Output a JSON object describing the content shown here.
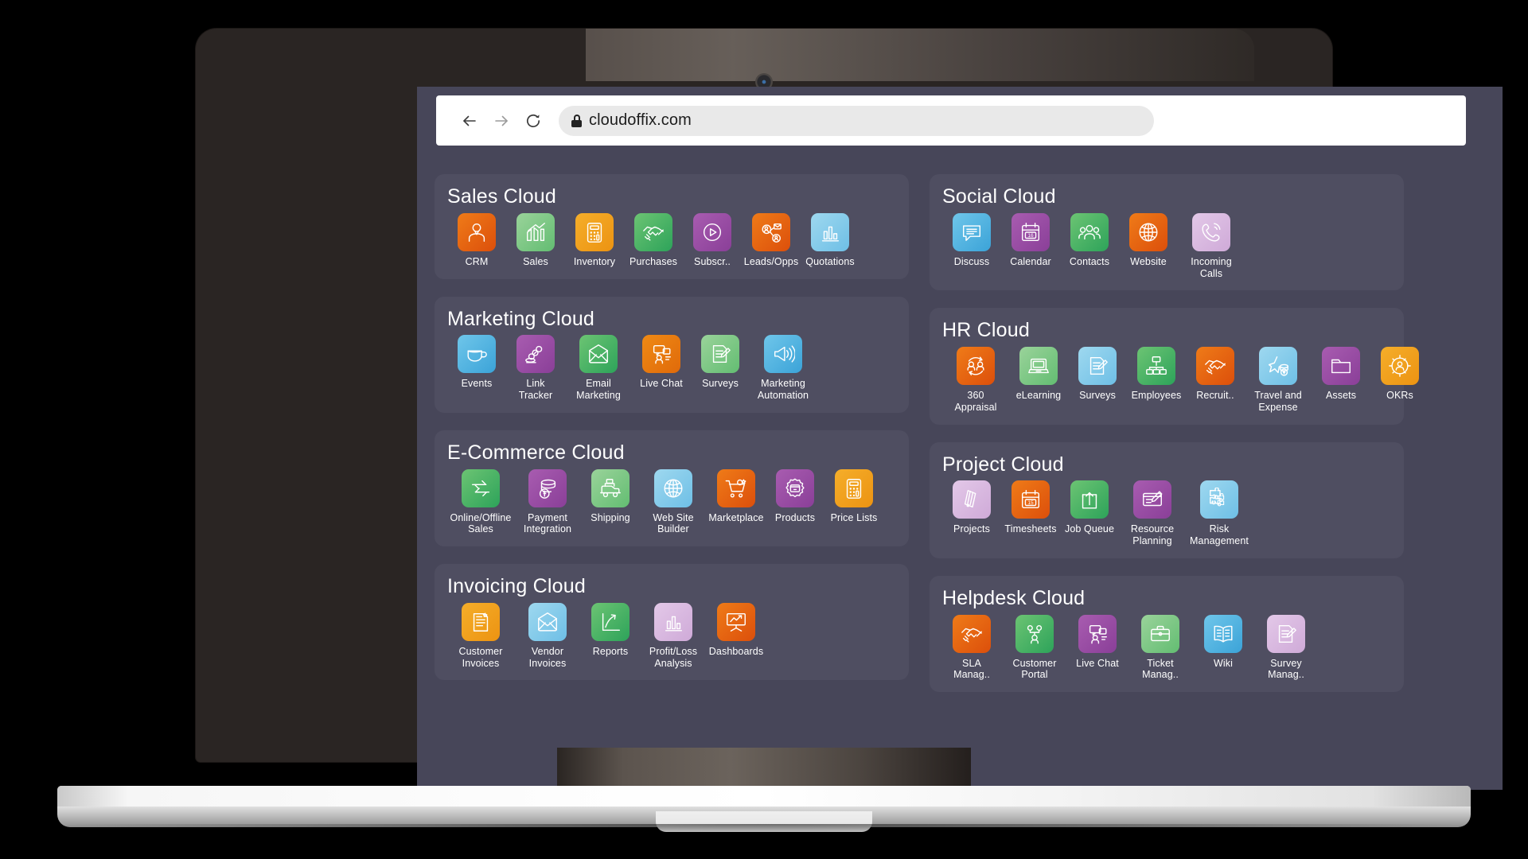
{
  "browser": {
    "back_label": "Back",
    "forward_label": "Forward",
    "reload_label": "Reload",
    "url": "cloudoffix.com",
    "lock_icon": "lock-icon"
  },
  "colors": {
    "page_bg": "#474659",
    "panel_bg": "#4f4e61",
    "orange": "#e8730d",
    "orange_red": "#e05a12",
    "green": "#42b35f",
    "light_green": "#82c97f",
    "purple": "#9b4fa5",
    "light_purple": "#d9b6df",
    "blue": "#57b4e2",
    "light_blue": "#86cbe9",
    "amber": "#f0a020"
  },
  "sections": [
    {
      "id": "sales-cloud",
      "title": "Sales Cloud",
      "column": "left",
      "apps": [
        {
          "label": "CRM",
          "icon": "user-profile-icon",
          "color": "orange-red"
        },
        {
          "label": "Sales",
          "icon": "bar-chart-growth-icon",
          "color": "light-green"
        },
        {
          "label": "Inventory",
          "icon": "calculator-icon",
          "color": "amber"
        },
        {
          "label": "Purchases",
          "icon": "handshake-icon",
          "color": "green"
        },
        {
          "label": "Subscr..",
          "icon": "play-circle-icon",
          "color": "purple"
        },
        {
          "label": "Leads/Opps",
          "icon": "leads-network-icon",
          "color": "orange-red"
        },
        {
          "label": "Quotations",
          "icon": "bar-chart-icon",
          "color": "light-blue"
        }
      ]
    },
    {
      "id": "social-cloud",
      "title": "Social Cloud",
      "column": "right",
      "apps": [
        {
          "label": "Discuss",
          "icon": "chat-bubble-icon",
          "color": "blue"
        },
        {
          "label": "Calendar",
          "icon": "calendar-icon",
          "color": "purple"
        },
        {
          "label": "Contacts",
          "icon": "people-group-icon",
          "color": "green"
        },
        {
          "label": "Website",
          "icon": "globe-icon",
          "color": "orange-red"
        },
        {
          "label": "Incoming\nCalls",
          "icon": "phone-ringing-icon",
          "color": "light-purple"
        }
      ]
    },
    {
      "id": "marketing-cloud",
      "title": "Marketing Cloud",
      "column": "left",
      "apps": [
        {
          "label": "Events",
          "icon": "coffee-cup-icon",
          "color": "blue"
        },
        {
          "label": "Link\nTracker",
          "icon": "link-chain-icon",
          "color": "purple"
        },
        {
          "label": "Email\nMarketing",
          "icon": "envelope-icon",
          "color": "green"
        },
        {
          "label": "Live Chat",
          "icon": "chat-support-icon",
          "color": "orange"
        },
        {
          "label": "Surveys",
          "icon": "survey-pencil-icon",
          "color": "light-green"
        },
        {
          "label": "Marketing\nAutomation",
          "icon": "megaphone-icon",
          "color": "blue"
        }
      ]
    },
    {
      "id": "hr-cloud",
      "title": "HR Cloud",
      "column": "right",
      "apps": [
        {
          "label": "360\nAppraisal",
          "icon": "appraisal-cycle-icon",
          "color": "orange-red"
        },
        {
          "label": "eLearning",
          "icon": "laptop-icon",
          "color": "light-green"
        },
        {
          "label": "Surveys",
          "icon": "survey-pencil-icon",
          "color": "light-blue"
        },
        {
          "label": "Employees",
          "icon": "org-chart-icon",
          "color": "green"
        },
        {
          "label": "Recruit..",
          "icon": "handshake-icon",
          "color": "orange-red"
        },
        {
          "label": "Travel and\nExpense",
          "icon": "travel-expense-icon",
          "color": "light-blue"
        },
        {
          "label": "Assets",
          "icon": "folder-icon",
          "color": "purple"
        },
        {
          "label": "OKRs",
          "icon": "okr-target-icon",
          "color": "amber"
        }
      ]
    },
    {
      "id": "ecommerce-cloud",
      "title": "E-Commerce Cloud",
      "column": "left",
      "apps": [
        {
          "label": "Online/Offline\nSales",
          "icon": "exchange-arrows-icon",
          "color": "green"
        },
        {
          "label": "Payment\nIntegration",
          "icon": "coins-stack-icon",
          "color": "purple"
        },
        {
          "label": "Shipping",
          "icon": "delivery-truck-icon",
          "color": "light-green"
        },
        {
          "label": "Web Site\nBuilder",
          "icon": "globe-icon",
          "color": "light-blue"
        },
        {
          "label": "Marketplace",
          "icon": "shopping-cart-icon",
          "color": "orange-red"
        },
        {
          "label": "Products",
          "icon": "gear-box-icon",
          "color": "purple"
        },
        {
          "label": "Price Lists",
          "icon": "calculator-icon",
          "color": "amber"
        }
      ]
    },
    {
      "id": "project-cloud",
      "title": "Project Cloud",
      "column": "right",
      "apps": [
        {
          "label": "Projects",
          "icon": "color-swatch-icon",
          "color": "light-purple"
        },
        {
          "label": "Timesheets",
          "icon": "calendar-15-icon",
          "color": "orange-red"
        },
        {
          "label": "Job Queue",
          "icon": "upload-box-icon",
          "color": "green"
        },
        {
          "label": "Resource\nPlanning",
          "icon": "planning-board-icon",
          "color": "purple"
        },
        {
          "label": "Risk\nManagement",
          "icon": "puzzle-icon",
          "color": "light-blue"
        }
      ]
    },
    {
      "id": "invoicing-cloud",
      "title": "Invoicing Cloud",
      "column": "left",
      "apps": [
        {
          "label": "Customer\nInvoices",
          "icon": "invoice-document-icon",
          "color": "amber"
        },
        {
          "label": "Vendor\nInvoices",
          "icon": "envelope-icon",
          "color": "light-blue"
        },
        {
          "label": "Reports",
          "icon": "growth-arrow-icon",
          "color": "green"
        },
        {
          "label": "Profit/Loss\nAnalysis",
          "icon": "bar-chart-icon",
          "color": "light-purple"
        },
        {
          "label": "Dashboards",
          "icon": "presentation-chart-icon",
          "color": "orange-red"
        }
      ]
    },
    {
      "id": "helpdesk-cloud",
      "title": "Helpdesk Cloud",
      "column": "right",
      "apps": [
        {
          "label": "SLA\nManag..",
          "icon": "handshake-icon",
          "color": "orange-red"
        },
        {
          "label": "Customer\nPortal",
          "icon": "customer-portal-icon",
          "color": "green"
        },
        {
          "label": "Live Chat",
          "icon": "chat-support-icon",
          "color": "purple"
        },
        {
          "label": "Ticket\nManag..",
          "icon": "briefcase-icon",
          "color": "light-green"
        },
        {
          "label": "Wiki",
          "icon": "open-book-icon",
          "color": "blue"
        },
        {
          "label": "Survey\nManag..",
          "icon": "survey-pencil-icon",
          "color": "light-purple"
        }
      ]
    }
  ]
}
